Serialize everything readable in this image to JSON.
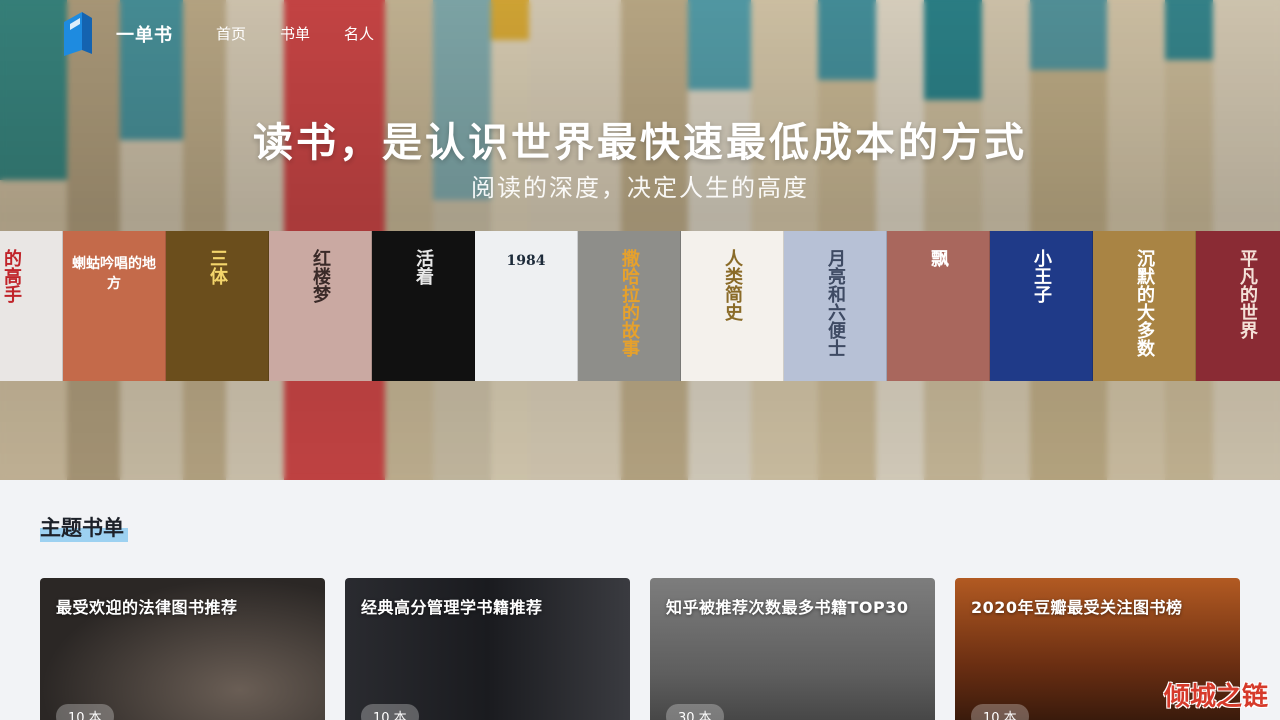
{
  "nav": {
    "brand": "一单书",
    "links": [
      "首页",
      "书单",
      "名人"
    ]
  },
  "hero": {
    "title": "读书，是认识世界最快速最低成本的方式",
    "subtitle": "阅读的深度，决定人生的高度"
  },
  "covers": [
    {
      "title": "的高手",
      "bg": "#e9e6e4",
      "fg": "#c0242a"
    },
    {
      "title": "蝲蛄吟唱的地方",
      "bg": "#c46a4a",
      "fg": "#fff"
    },
    {
      "title": "三体",
      "bg": "#6b4e1c",
      "fg": "#f4d56b"
    },
    {
      "title": "红楼梦",
      "bg": "#caa9a2",
      "fg": "#3a2a28"
    },
    {
      "title": "活着",
      "bg": "#111111",
      "fg": "#e8e8e8"
    },
    {
      "title": "1984",
      "bg": "#eef0f2",
      "fg": "#1d2b3a"
    },
    {
      "title": "撒哈拉的故事",
      "bg": "#8e8e8a",
      "fg": "#e6a12c"
    },
    {
      "title": "人类简史",
      "bg": "#f4f1ec",
      "fg": "#8a6b28"
    },
    {
      "title": "月亮和六便士",
      "bg": "#b7c1d6",
      "fg": "#3e4a63"
    },
    {
      "title": "飘",
      "bg": "#a9675d",
      "fg": "#fff"
    },
    {
      "title": "小王子",
      "bg": "#1f3a88",
      "fg": "#ffffff"
    },
    {
      "title": "沉默的大多数",
      "bg": "#a98444",
      "fg": "#fff"
    },
    {
      "title": "平凡的世界",
      "bg": "#8a2b34",
      "fg": "#f4e1d8"
    }
  ],
  "section": {
    "title": "主题书单"
  },
  "cards": [
    {
      "title": "最受欢迎的法律图书推荐",
      "count": "10 本",
      "tone": "#3a3532"
    },
    {
      "title": "经典高分管理学书籍推荐",
      "count": "10 本",
      "tone": "#24252a"
    },
    {
      "title": "知乎被推荐次数最多书籍TOP30",
      "count": "30 本",
      "tone": "#6f6f6f"
    },
    {
      "title": "2020年豆瓣最受关注图书榜",
      "count": "10 本",
      "tone": "#7a3a1a"
    }
  ],
  "watermark": "倾城之链"
}
